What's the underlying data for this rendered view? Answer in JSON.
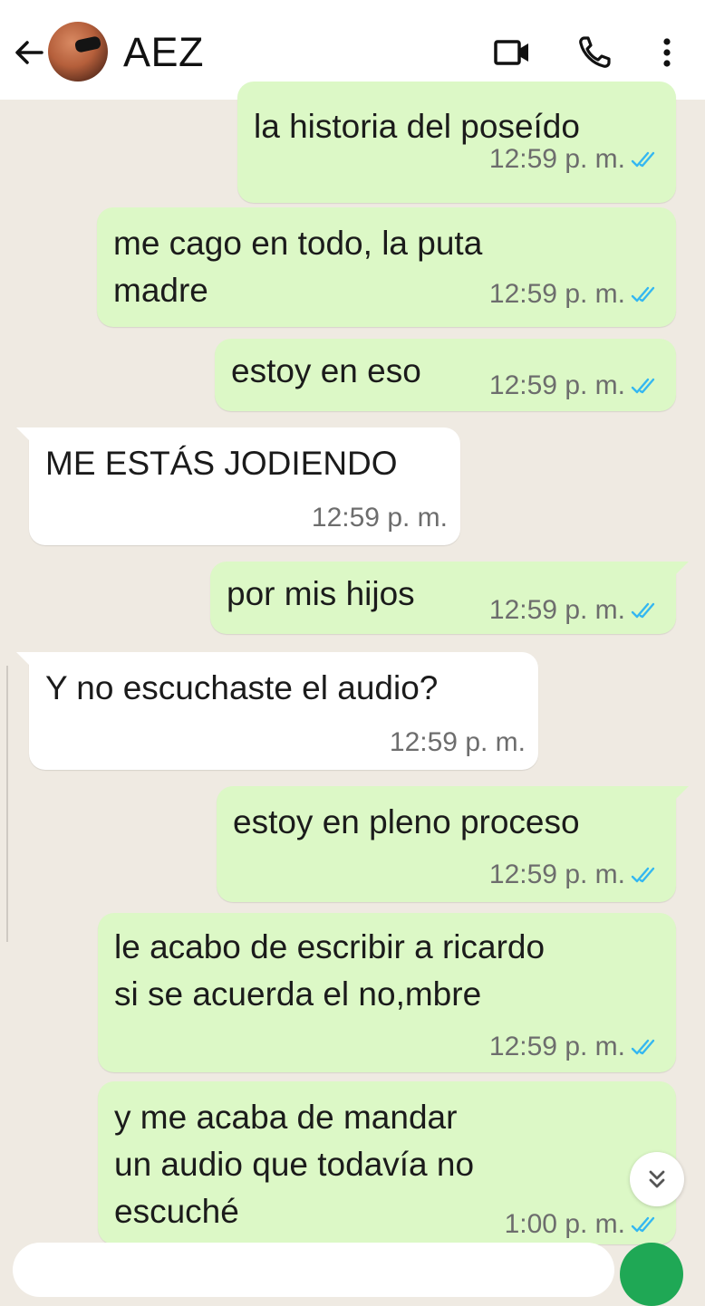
{
  "header": {
    "contact_name": "AEZ",
    "icons": [
      "back-arrow-icon",
      "video-call-icon",
      "phone-icon",
      "more-vert-icon"
    ]
  },
  "messages": [
    {
      "direction": "out",
      "lines": [
        "la historia del poseído"
      ],
      "time": "12:59 p. m.",
      "status": "read"
    },
    {
      "direction": "out",
      "lines": [
        "me cago en todo, la puta",
        "madre"
      ],
      "time": "12:59 p. m.",
      "status": "read"
    },
    {
      "direction": "out",
      "lines": [
        "estoy en eso"
      ],
      "time": "12:59 p. m.",
      "status": "read"
    },
    {
      "direction": "in",
      "lines": [
        "ME ESTÁS JODIENDO"
      ],
      "time": "12:59 p. m."
    },
    {
      "direction": "out",
      "lines": [
        "por mis hijos"
      ],
      "time": "12:59 p. m.",
      "status": "read"
    },
    {
      "direction": "in",
      "lines": [
        "Y no escuchaste el audio?"
      ],
      "time": "12:59 p. m."
    },
    {
      "direction": "out",
      "lines": [
        "estoy en pleno proceso"
      ],
      "time": "12:59 p. m.",
      "status": "read"
    },
    {
      "direction": "out",
      "lines": [
        "le acabo de escribir a ricardo",
        "si se acuerda el no,mbre"
      ],
      "time": "12:59 p. m.",
      "status": "read"
    },
    {
      "direction": "out",
      "lines": [
        "y me acaba de mandar",
        "un audio que todavía no",
        "escuché"
      ],
      "time": "1:00 p. m.",
      "status": "read"
    }
  ],
  "colors": {
    "chat_background": "#efeae2",
    "outgoing_bubble": "#dcf8c6",
    "incoming_bubble": "#ffffff",
    "read_tick": "#34b7f1",
    "fab": "#1fa855"
  }
}
